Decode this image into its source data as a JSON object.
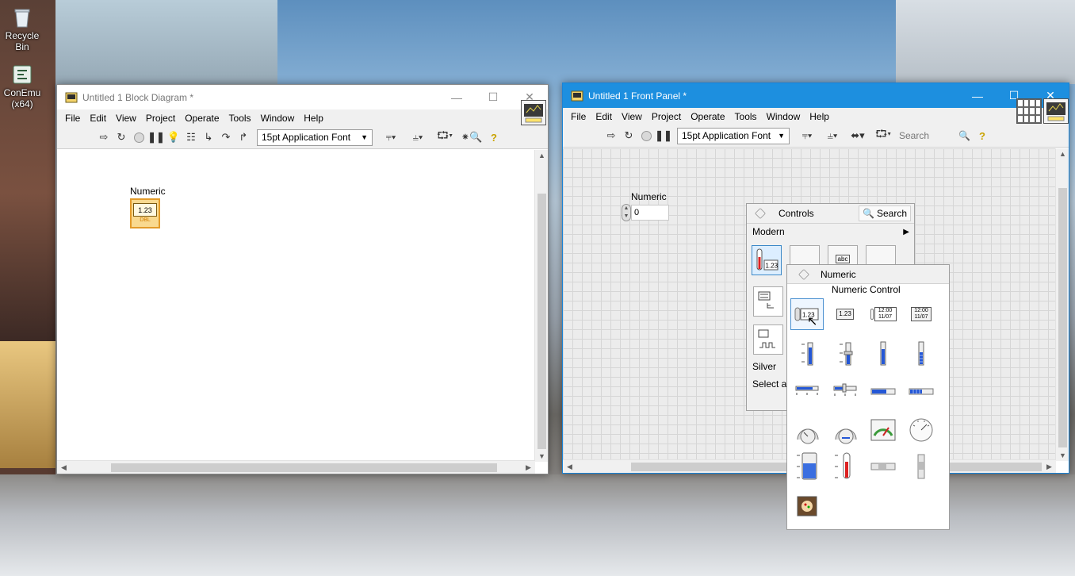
{
  "desktop": {
    "icons": [
      {
        "label": "Recycle Bin"
      },
      {
        "label": "ConEmu\n(x64)"
      }
    ]
  },
  "block_diagram": {
    "title": "Untitled 1 Block Diagram *",
    "menus": [
      "File",
      "Edit",
      "View",
      "Project",
      "Operate",
      "Tools",
      "Window",
      "Help"
    ],
    "font_select": "15pt Application Font",
    "terminal": {
      "label": "Numeric",
      "value": "1.23",
      "type": "DBL"
    }
  },
  "front_panel": {
    "title": "Untitled 1 Front Panel *",
    "menus": [
      "File",
      "Edit",
      "View",
      "Project",
      "Operate",
      "Tools",
      "Window",
      "Help"
    ],
    "font_select": "15pt Application Font",
    "search_placeholder": "Search",
    "control": {
      "label": "Numeric",
      "value": "0"
    }
  },
  "controls_palette": {
    "title": "Controls",
    "search_label": "Search",
    "category": "Modern",
    "items": [
      "Silver",
      "Select a"
    ]
  },
  "numeric_palette": {
    "title": "Numeric",
    "tooltip": "Numeric Control",
    "labels": {
      "dbl": "1.23",
      "time1": "12:00",
      "date1": "11/07",
      "time2": "12:00",
      "date2": "11/07"
    }
  }
}
